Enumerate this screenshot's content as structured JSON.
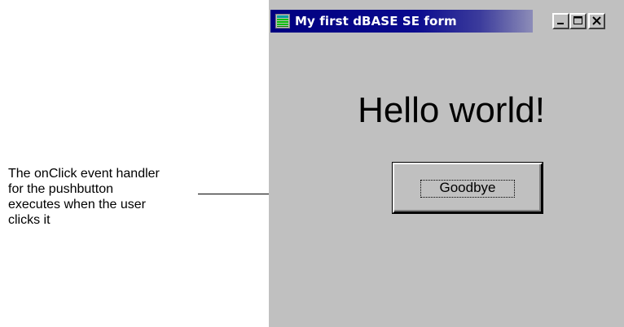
{
  "annotation": {
    "text": "The onClick event handler\nfor the pushbutton\nexecutes when the user\nclicks it"
  },
  "window": {
    "title": "My first dBASE SE form",
    "app_icon": "dbase-form-icon",
    "controls": {
      "minimize_icon": "minimize-icon",
      "maximize_icon": "maximize-icon",
      "close_icon": "close-icon"
    }
  },
  "form": {
    "heading": "Hello world!",
    "button_label": "Goodbye"
  },
  "colors": {
    "titlebar": "#000080",
    "window_face": "#c0c0c0",
    "title_text": "#ffffff"
  }
}
